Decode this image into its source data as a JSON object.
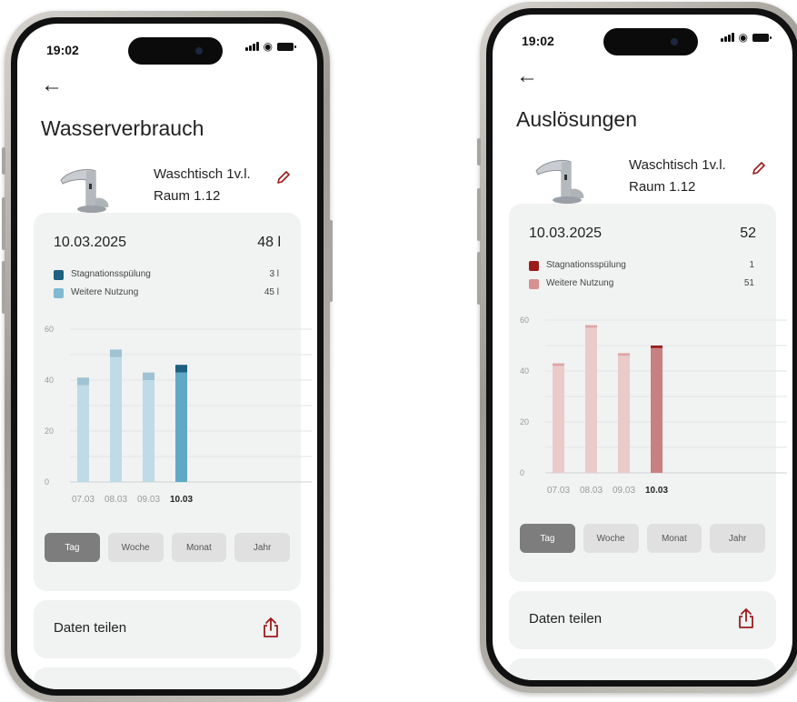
{
  "screens": [
    {
      "status_time": "19:02",
      "back_icon": "arrow-left-icon",
      "title": "Wasserverbrauch",
      "product": {
        "name_line1": "Waschtisch 1v.l.",
        "name_line2": "Raum 1.12",
        "icon": "faucet-image"
      },
      "edit_icon": "pencil-icon",
      "summary": {
        "date": "10.03.2025",
        "total": "48 l"
      },
      "legend": [
        {
          "label": "Stagnationsspülung",
          "value": "3 l",
          "color": "#1e5f82"
        },
        {
          "label": "Weitere Nutzung",
          "value": "45 l",
          "color": "#7fbad2"
        }
      ],
      "chart_data": {
        "type": "bar",
        "categories": [
          "07.03",
          "08.03",
          "09.03",
          "10.03"
        ],
        "selected_category": "10.03",
        "series": [
          {
            "name": "Weitere Nutzung",
            "values": [
              38,
              49,
              40,
              43
            ]
          },
          {
            "name": "Stagnationsspülung",
            "values": [
              3,
              3,
              3,
              3
            ]
          }
        ],
        "y_ticks": [
          "0",
          "20",
          "40",
          "60"
        ],
        "ylim": [
          0,
          60
        ],
        "colors": {
          "base_light": "#bfdbe7",
          "top_light": "#9fc3d3",
          "base_selected": "#5fa9c6",
          "top_selected": "#1e5f82"
        }
      },
      "period_tabs": [
        "Tag",
        "Woche",
        "Monat",
        "Jahr"
      ],
      "active_tab": "Tag",
      "share": {
        "label": "Daten teilen",
        "icon": "share-icon",
        "color": "#9b1b1b"
      }
    },
    {
      "status_time": "19:02",
      "back_icon": "arrow-left-icon",
      "title": "Auslösungen",
      "product": {
        "name_line1": "Waschtisch 1v.l.",
        "name_line2": "Raum 1.12",
        "icon": "faucet-image"
      },
      "edit_icon": "pencil-icon",
      "summary": {
        "date": "10.03.2025",
        "total": "52"
      },
      "legend": [
        {
          "label": "Stagnationsspülung",
          "value": "1",
          "color": "#9b1b1b"
        },
        {
          "label": "Weitere Nutzung",
          "value": "51",
          "color": "#d99090"
        }
      ],
      "chart_data": {
        "type": "bar",
        "categories": [
          "07.03",
          "08.03",
          "09.03",
          "10.03"
        ],
        "selected_category": "10.03",
        "series": [
          {
            "name": "Weitere Nutzung",
            "values": [
              42,
              57,
              46,
              49
            ]
          },
          {
            "name": "Stagnationsspülung",
            "values": [
              1,
              1,
              1,
              1
            ]
          }
        ],
        "y_ticks": [
          "0",
          "20",
          "40",
          "60"
        ],
        "ylim": [
          0,
          60
        ],
        "colors": {
          "base_light": "#ebcaca",
          "top_light": "#dda5a5",
          "base_selected": "#c98080",
          "top_selected": "#9b1b1b"
        }
      },
      "period_tabs": [
        "Tag",
        "Woche",
        "Monat",
        "Jahr"
      ],
      "active_tab": "Tag",
      "share": {
        "label": "Daten teilen",
        "icon": "share-icon",
        "color": "#9b1b1b"
      }
    }
  ]
}
